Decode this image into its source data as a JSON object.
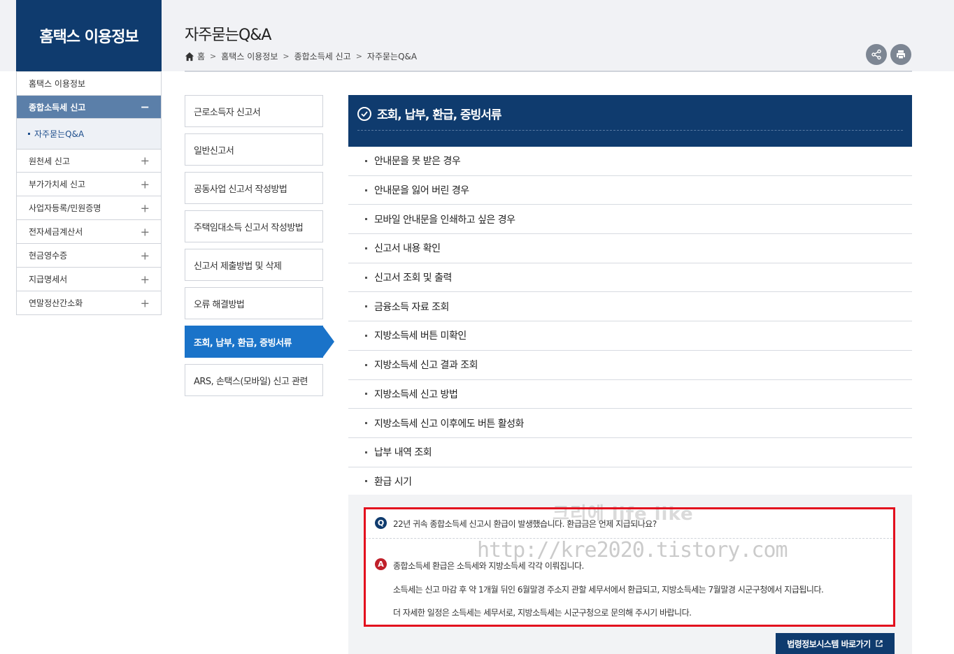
{
  "header": {
    "section_title": "홈택스 이용정보",
    "page_title": "자주묻는Q&A",
    "breadcrumb": [
      "홈",
      "홈택스 이용정보",
      "종합소득세 신고",
      "자주묻는Q&A"
    ]
  },
  "sidebar": {
    "top_item": "홈택스 이용정보",
    "active_item": "종합소득세 신고",
    "active_sub": "자주묻는Q&A",
    "items": [
      "원천세 신고",
      "부가가치세 신고",
      "사업자등록/민원증명",
      "전자세금계산서",
      "현금영수증",
      "지급명세서",
      "연말정산간소화"
    ],
    "collapse_symbol": "−",
    "expand_symbol": "+"
  },
  "categories": [
    "근로소득자 신고서",
    "일반신고서",
    "공동사업 신고서 작성방법",
    "주택임대소득 신고서 작성방법",
    "신고서 제출방법 및 삭제",
    "오류 해결방법",
    "조회, 납부, 환급, 증빙서류",
    "ARS, 손택스(모바일) 신고 관련"
  ],
  "panel": {
    "title": "조회, 납부, 환급, 증빙서류",
    "questions": [
      "안내문을 못 받은 경우",
      "안내문을 잃어 버린 경우",
      "모바일 안내문을 인쇄하고 싶은 경우",
      "신고서 내용 확인",
      "신고서 조회 및 출력",
      "금융소득 자료 조회",
      "지방소득세 버튼 미확인",
      "지방소득세 신고 결과 조회",
      "지방소득세 신고 방법",
      "지방소득세 신고 이후에도 버튼 활성화",
      "납부 내역 조회",
      "환급 시기"
    ]
  },
  "qa": {
    "q_badge": "Q",
    "a_badge": "A",
    "question": "22년 귀속 종합소득세 신고시 환급이 발생했습니다. 환급금은 언제 지급되나요?",
    "answer_1": "종합소득세 환급은 소득세와 지방소득세 각각 이뤄집니다.",
    "answer_2": "소득세는 신고 마감 후 약 1개월 뒤인 6월말경 주소지 관할 세무서에서 환급되고, 지방소득세는 7월말경 시군구청에서 지급됩니다.",
    "answer_3": "더 자세한 일정은 소득세는 세무서로, 지방소득세는 시군구청으로 문의해 주시기 바랍니다."
  },
  "watermark": {
    "line1": "크리에 life like",
    "line2": "http://kre2020.tistory.com"
  },
  "law_button": "법령정보시스템 바로가기",
  "colors": {
    "navy": "#0f3b6e",
    "active_blue": "#1a73c9",
    "sidebar_active": "#5b7fa9",
    "highlight_red": "#e3101e"
  }
}
